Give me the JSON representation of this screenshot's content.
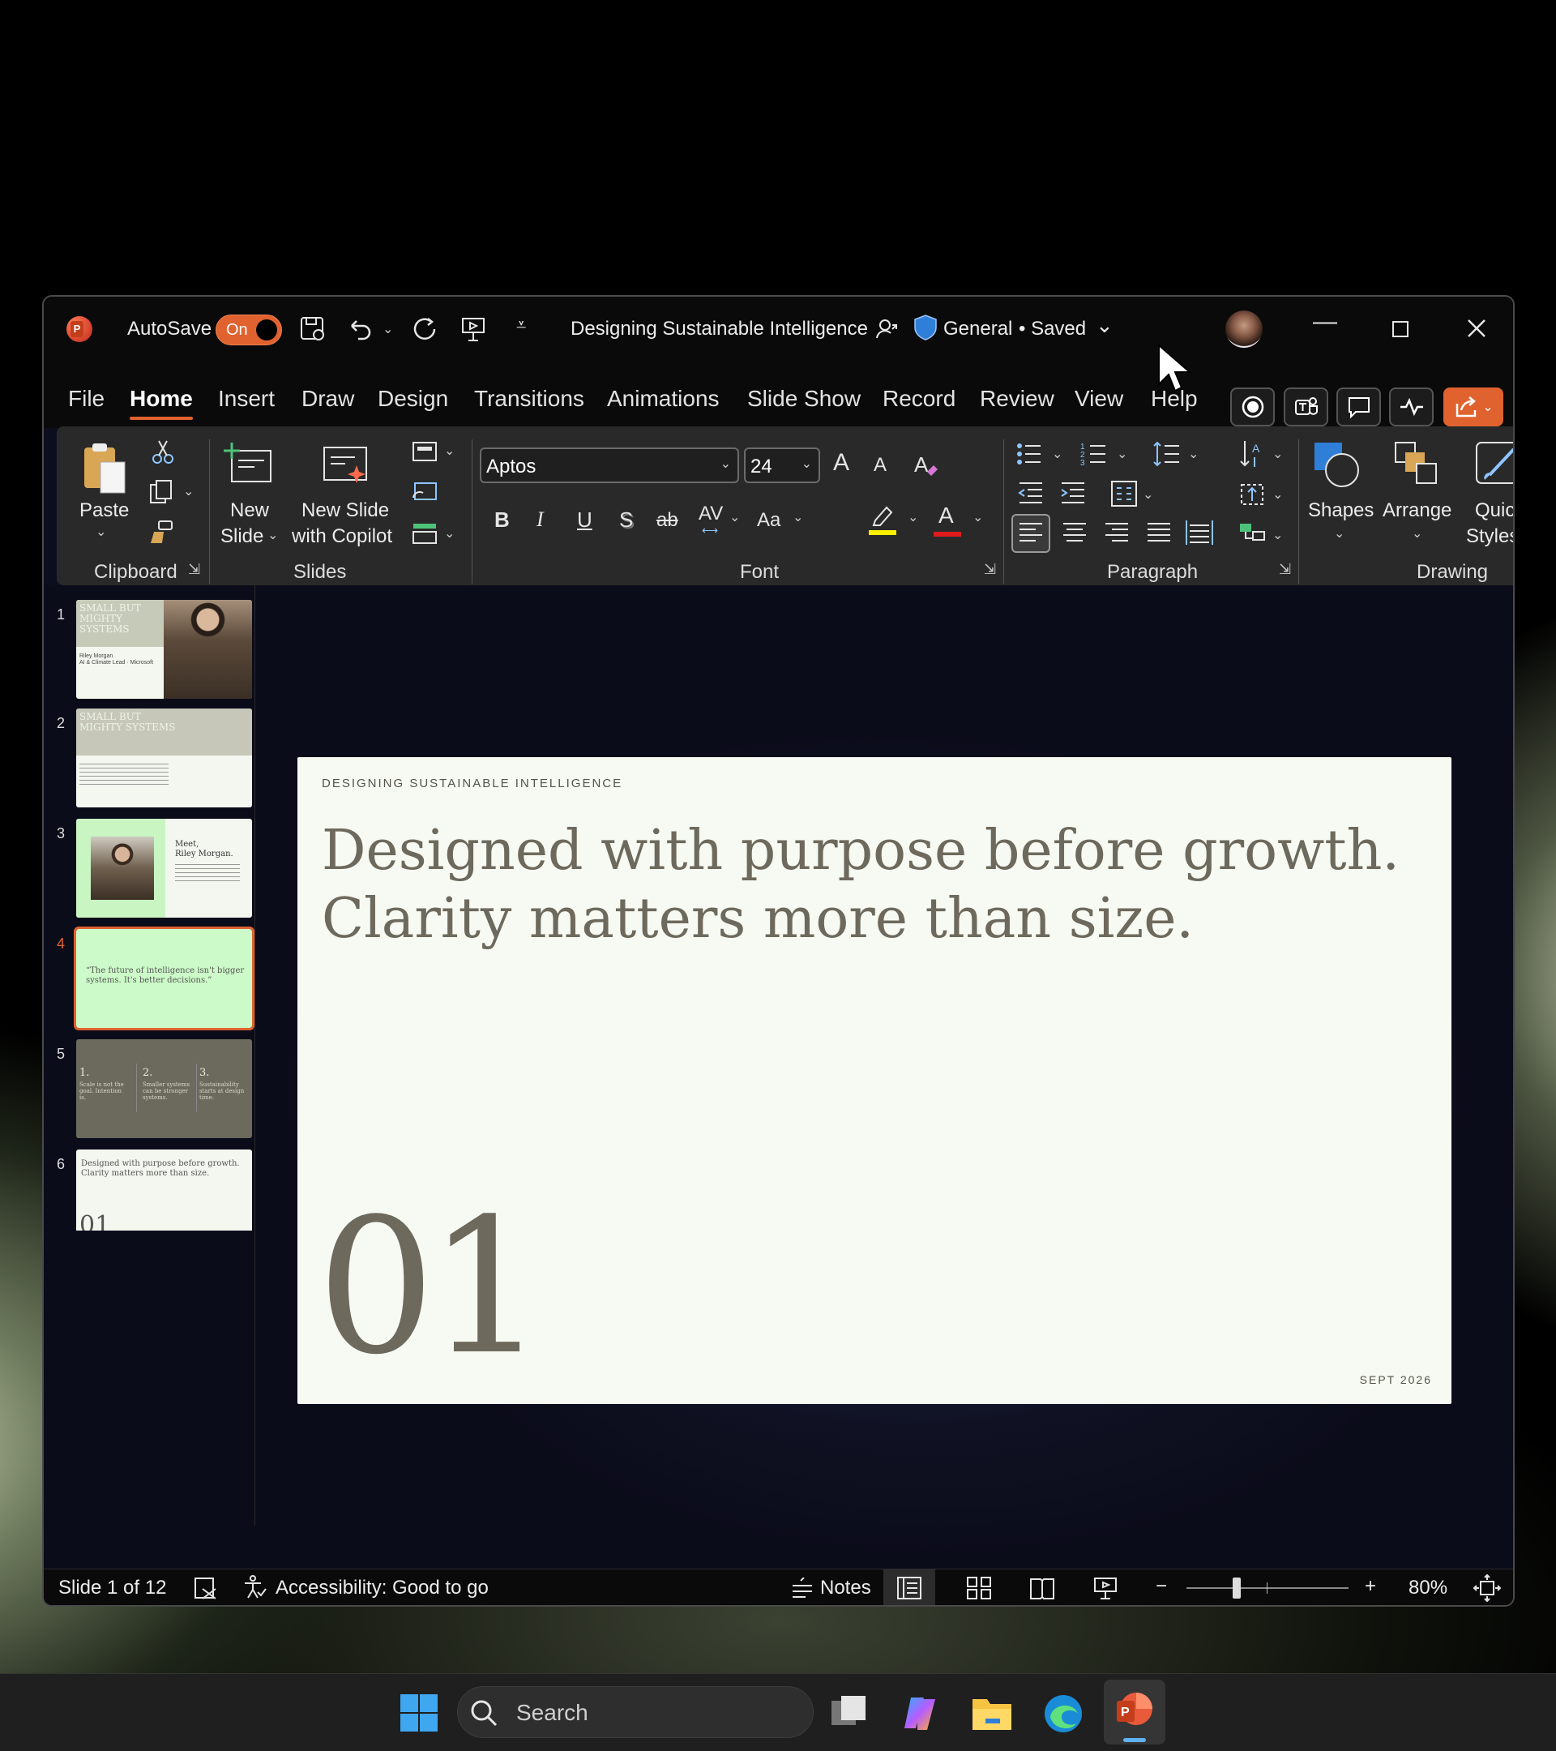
{
  "titlebar": {
    "autosave_label": "AutoSave",
    "autosave_state": "On",
    "doc_title": "Designing Sustainable Intelligence",
    "sensitivity": "General",
    "save_state": "• Saved"
  },
  "tabs": [
    "File",
    "Home",
    "Insert",
    "Draw",
    "Design",
    "Transitions",
    "Animations",
    "Slide Show",
    "Record",
    "Review",
    "View",
    "Help"
  ],
  "ribbon": {
    "paste": "Paste",
    "clipboard_label": "Clipboard",
    "new_slide_1": "New",
    "new_slide_2": "Slide",
    "copilot_1": "New Slide",
    "copilot_2": "with Copilot",
    "slides_label": "Slides",
    "font_name": "Aptos",
    "font_size": "24",
    "font_label": "Font",
    "bold": "B",
    "italic": "I",
    "underline": "U",
    "shadow": "S",
    "strike": "ab",
    "spacing": "AV",
    "case": "Aa",
    "grow": "A",
    "shrink": "A",
    "font_color": "A",
    "paragraph_label": "Paragraph",
    "shapes": "Shapes",
    "arrange": "Arrange",
    "quick_1": "Quick",
    "quick_2": "Styles",
    "drawing_label": "Drawing"
  },
  "thumbnails": [
    {
      "num": "1",
      "title": "SMALL BUT MIGHTY SYSTEMS",
      "sub": "Riley Morgan\nAI & Climate Lead · Microsoft"
    },
    {
      "num": "2",
      "title": "SMALL BUT MIGHTY SYSTEMS"
    },
    {
      "num": "3",
      "title": "Meet,\nRiley Morgan."
    },
    {
      "num": "4",
      "quote": "“The future of intelligence isn't bigger systems. It's better decisions.”"
    },
    {
      "num": "5",
      "cols": [
        {
          "n": "1.",
          "t": "Scale is not the goal. Intention is."
        },
        {
          "n": "2.",
          "t": "Smaller systems can be stronger systems."
        },
        {
          "n": "3.",
          "t": "Sustainability starts at design time."
        }
      ]
    },
    {
      "num": "6",
      "text": "Designed with purpose before growth. Clarity matters more than size.",
      "big": "01"
    }
  ],
  "slide": {
    "kicker": "DESIGNING SUSTAINABLE INTELLIGENCE",
    "headline_1": "Designed with purpose before growth.",
    "headline_2": "Clarity matters more than size.",
    "number": "01",
    "date": "SEPT 2026"
  },
  "status": {
    "slide_count": "Slide 1 of 12",
    "accessibility": "Accessibility: Good to go",
    "notes": "Notes",
    "zoom": "80%",
    "zoom_minus": "−",
    "zoom_plus": "+",
    "zoom_level": 0.31
  },
  "taskbar": {
    "search_placeholder": "Search"
  },
  "colors": {
    "accent": "#e0622f",
    "slide_bg": "#f6faf2",
    "slide_text": "#6d695c",
    "thumb_green": "#ccfac8",
    "thumb_olive": "#6b6a5c"
  }
}
